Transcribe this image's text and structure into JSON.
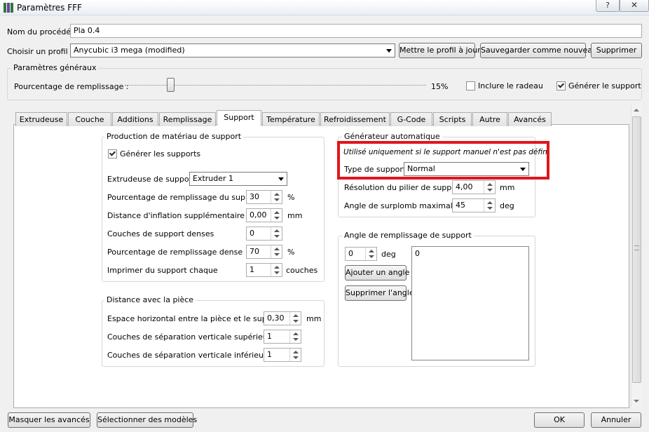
{
  "window": {
    "title": "Paramètres FFF",
    "help_glyph": "?",
    "close_glyph": "✕"
  },
  "process": {
    "name_label": "Nom du procédé :",
    "name_value": "Pla 0.4",
    "profile_label": "Choisir un profil :",
    "profile_value": "Anycubic i3 mega (modified)",
    "btn_update": "Mettre le profil à jour",
    "btn_save_new": "Sauvegarder comme nouveau",
    "btn_delete": "Supprimer"
  },
  "general": {
    "title": "Paramètres généraux",
    "infill_label": "Pourcentage de remplissage :",
    "infill_value": "15%",
    "infill_fraction": 0.15,
    "raft_label": "Inclure le radeau",
    "raft_checked": false,
    "support_label": "Générer le support",
    "support_checked": true
  },
  "tabs": [
    {
      "label": "Extrudeuse"
    },
    {
      "label": "Couche"
    },
    {
      "label": "Additions"
    },
    {
      "label": "Remplissage"
    },
    {
      "label": "Support",
      "active": true
    },
    {
      "label": "Température"
    },
    {
      "label": "Refroidissement"
    },
    {
      "label": "G-Code"
    },
    {
      "label": "Scripts"
    },
    {
      "label": "Autre"
    },
    {
      "label": "Avancés"
    }
  ],
  "support_material": {
    "title": "Production de matériau de support",
    "generate_label": "Générer les supports",
    "generate_checked": true,
    "extruder_label": "Extrudeuse de support",
    "extruder_value": "Extruder 1",
    "infill_pct_label": "Pourcentage de remplissage du support",
    "infill_pct_value": "30",
    "infill_pct_unit": "%",
    "inflation_label": "Distance d'inflation supplémentaire",
    "inflation_value": "0,00",
    "inflation_unit": "mm",
    "dense_layers_label": "Couches de support denses",
    "dense_layers_value": "0",
    "dense_infill_label": "Pourcentage de remplissage dense",
    "dense_infill_value": "70",
    "dense_infill_unit": "%",
    "print_every_label": "Imprimer du support chaque",
    "print_every_value": "1",
    "print_every_unit": "couches"
  },
  "part_distance": {
    "title": "Distance avec la pièce",
    "horizontal_label": "Espace horizontal entre la pièce et le support",
    "horizontal_value": "0,30",
    "horizontal_unit": "mm",
    "top_label": "Couches de séparation verticale supérieure",
    "top_value": "1",
    "bottom_label": "Couches de séparation verticale inférieure",
    "bottom_value": "1"
  },
  "auto_generator": {
    "title": "Générateur automatique",
    "note": "Utilisé uniquement si le support manuel n'est pas défini",
    "type_label": "Type de support",
    "type_value": "Normal",
    "pillar_label": "Résolution du pilier de support",
    "pillar_value": "4,00",
    "pillar_unit": "mm",
    "overhang_label": "Angle de surplomb maximal",
    "overhang_value": "45",
    "overhang_unit": "deg",
    "highlight_color": "#e0161d"
  },
  "infill_angle": {
    "title": "Angle de remplissage de support",
    "angle_value": "0",
    "angle_unit": "deg",
    "btn_add": "Ajouter un angle",
    "btn_remove": "Supprimer l'angle",
    "list_items": [
      "0"
    ]
  },
  "footer": {
    "btn_hide_advanced": "Masquer les avancés",
    "btn_select_models": "Sélectionner des modèles",
    "btn_ok": "OK",
    "btn_cancel": "Annuler"
  }
}
